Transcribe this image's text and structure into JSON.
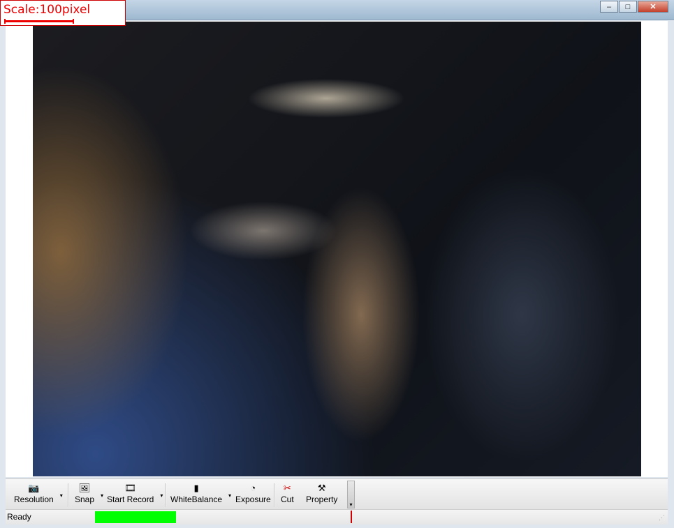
{
  "scale": {
    "label": "Scale:100pixel"
  },
  "window_buttons": {
    "minimize": "–",
    "maximize": "□",
    "close": "✕"
  },
  "toolbar": {
    "resolution": "Resolution",
    "snap": "Snap",
    "start_record": "Start Record",
    "white_balance": "WhiteBalance",
    "exposure": "Exposure",
    "cut": "Cut",
    "property": "Property",
    "dropdown_arrow": "▾",
    "overflow": "▾"
  },
  "status": {
    "text": "Ready",
    "progress_color": "#00ff00",
    "marker_color": "#d00000"
  },
  "icons": {
    "resolution": "camera-icon",
    "snap": "snapshot-icon",
    "start_record": "film-icon",
    "white_balance": "color-bars-icon",
    "exposure": "exposure-icon",
    "cut": "scissors-icon",
    "property": "hammer-icon"
  }
}
